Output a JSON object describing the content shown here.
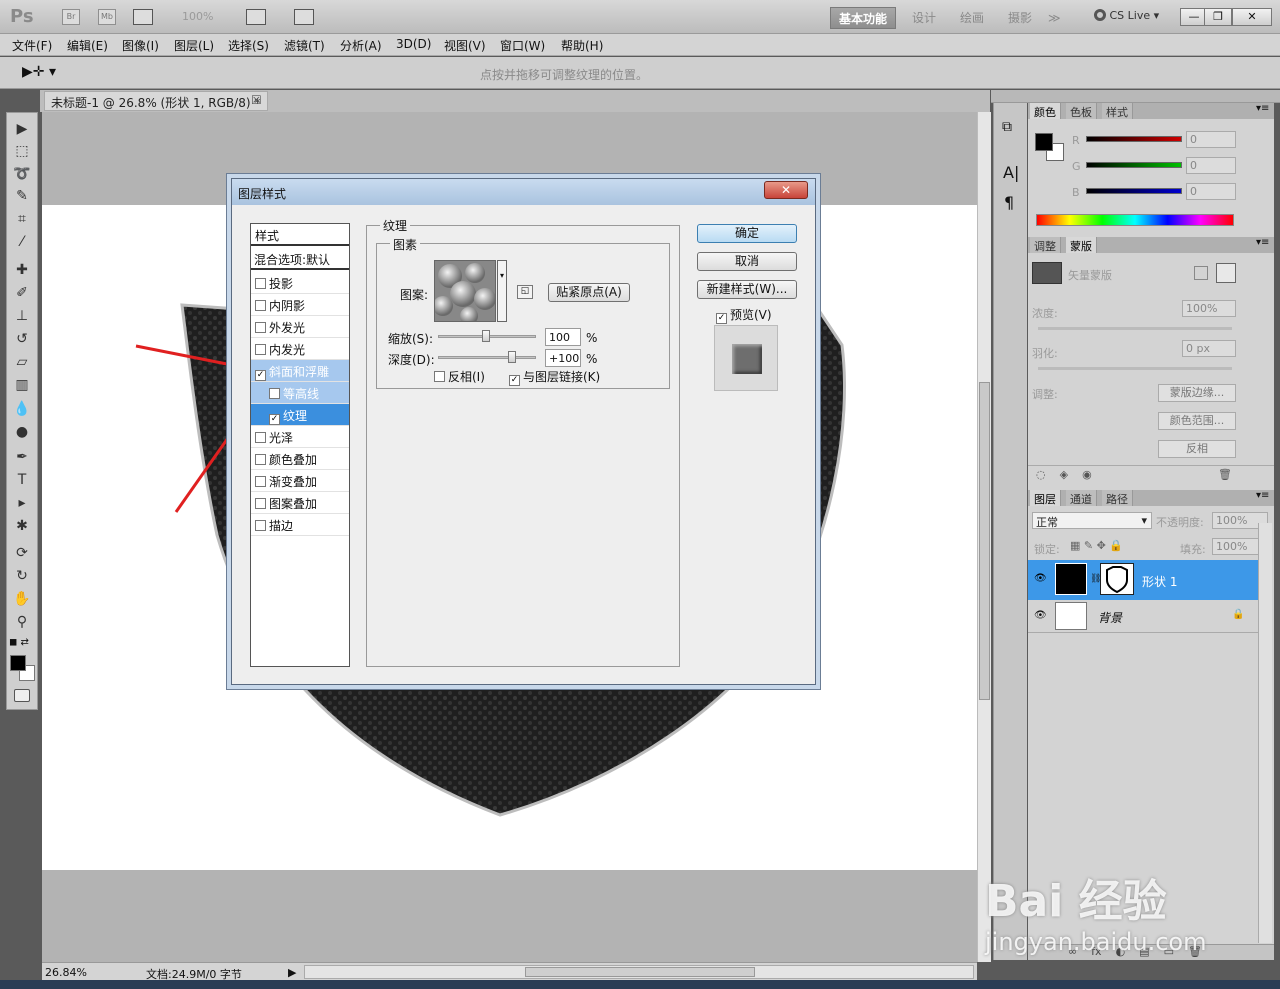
{
  "app": {
    "logo": "Ps",
    "title_icons": [
      "Br",
      "Mb"
    ],
    "zoom": "100%",
    "workspaces": [
      {
        "label": "基本功能",
        "active": true
      },
      {
        "label": "设计",
        "active": false
      },
      {
        "label": "绘画",
        "active": false
      },
      {
        "label": "摄影",
        "active": false
      }
    ],
    "more": "≫",
    "cs_live": "CS Live",
    "window_buttons": [
      "—",
      "❐",
      "✕"
    ]
  },
  "menu": [
    "文件(F)",
    "编辑(E)",
    "图像(I)",
    "图层(L)",
    "选择(S)",
    "滤镜(T)",
    "分析(A)",
    "3D(D)",
    "视图(V)",
    "窗口(W)",
    "帮助(H)"
  ],
  "options_bar": {
    "hint": "点按并拖移可调整纹理的位置。"
  },
  "document": {
    "tab_title": "未标题-1 @ 26.8% (形状 1, RGB/8) *",
    "tab_close": "☒",
    "zoom": "26.84%",
    "doc_info": "文档:24.9M/0 字节"
  },
  "dialog": {
    "title": "图层样式",
    "close": "✕",
    "styles_header": "样式",
    "blend_options": "混合选项:默认",
    "styles": [
      {
        "label": "投影",
        "checked": false,
        "state": "none",
        "indent": false
      },
      {
        "label": "内阴影",
        "checked": false,
        "state": "none",
        "indent": false
      },
      {
        "label": "外发光",
        "checked": false,
        "state": "none",
        "indent": false
      },
      {
        "label": "内发光",
        "checked": false,
        "state": "none",
        "indent": false
      },
      {
        "label": "斜面和浮雕",
        "checked": true,
        "state": "parent",
        "indent": false
      },
      {
        "label": "等高线",
        "checked": false,
        "state": "parent",
        "indent": true
      },
      {
        "label": "纹理",
        "checked": true,
        "state": "selected",
        "indent": true
      },
      {
        "label": "光泽",
        "checked": false,
        "state": "none",
        "indent": false
      },
      {
        "label": "颜色叠加",
        "checked": false,
        "state": "none",
        "indent": false
      },
      {
        "label": "渐变叠加",
        "checked": false,
        "state": "none",
        "indent": false
      },
      {
        "label": "图案叠加",
        "checked": false,
        "state": "none",
        "indent": false
      },
      {
        "label": "描边",
        "checked": false,
        "state": "none",
        "indent": false
      }
    ],
    "section_title": "纹理",
    "group_title": "图素",
    "pattern_label": "图案:",
    "snap_button": "贴紧原点(A)",
    "scale_label": "缩放(S):",
    "scale_value": "100",
    "scale_unit": "%",
    "depth_label": "深度(D):",
    "depth_value": "+100",
    "depth_unit": "%",
    "invert": {
      "label": "反相(I)",
      "checked": false
    },
    "link": {
      "label": "与图层链接(K)",
      "checked": true
    },
    "ok": "确定",
    "cancel": "取消",
    "new_style": "新建样式(W)...",
    "preview": {
      "label": "预览(V)",
      "checked": true
    }
  },
  "color_panel": {
    "tabs": [
      "颜色",
      "色板",
      "样式"
    ],
    "channels": [
      {
        "name": "R",
        "value": "0"
      },
      {
        "name": "G",
        "value": "0"
      },
      {
        "name": "B",
        "value": "0"
      }
    ]
  },
  "mask_panel": {
    "tabs": [
      "调整",
      "蒙版"
    ],
    "title": "矢量蒙版",
    "density_label": "浓度:",
    "density_value": "100%",
    "feather_label": "羽化:",
    "feather_value": "0 px",
    "adjust_label": "调整:",
    "buttons": [
      "蒙版边缘...",
      "颜色范围...",
      "反相"
    ]
  },
  "layers_panel": {
    "tabs": [
      "图层",
      "通道",
      "路径"
    ],
    "blend_mode": "正常",
    "opacity_label": "不透明度:",
    "opacity_value": "100%",
    "lock_label": "锁定:",
    "fill_label": "填充:",
    "fill_value": "100%",
    "layers": [
      {
        "name": "形状 1",
        "selected": true,
        "locked": false
      },
      {
        "name": "背景",
        "selected": false,
        "locked": true
      }
    ],
    "footer_icons": [
      "∞",
      "fx",
      "◐",
      "▤",
      "▭",
      "🗑"
    ]
  },
  "watermark": {
    "brand": "Bai 经验",
    "url": "jingyan.baidu.com"
  }
}
